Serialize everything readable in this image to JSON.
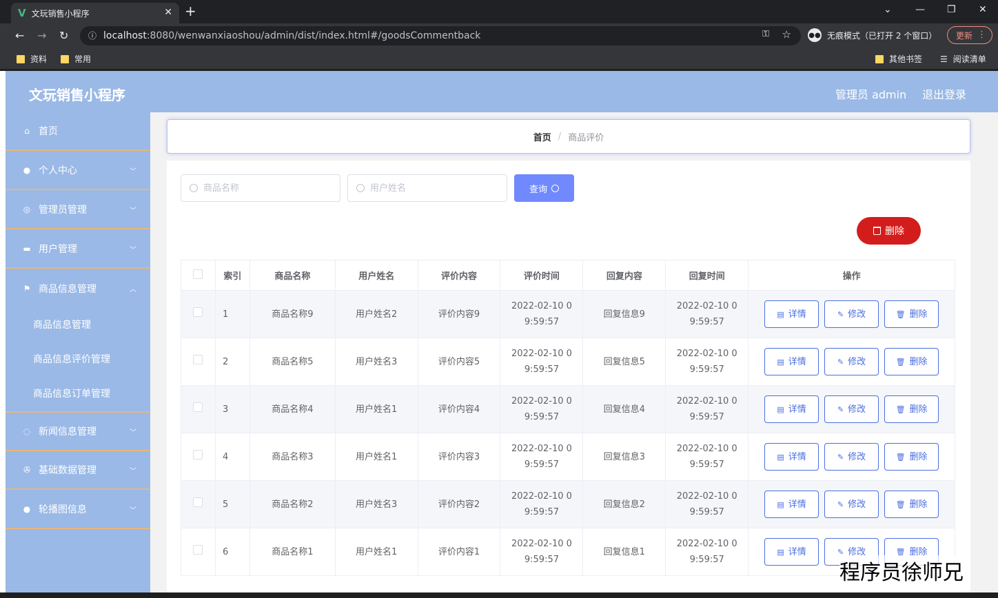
{
  "browser": {
    "tab_title": "文玩销售小程序",
    "tab_close": "✕",
    "new_tab": "+",
    "url_host": "localhost",
    "url_rest": ":8080/wenwanxiaoshou/admin/dist/index.html#/goodsCommentback",
    "incognito_label": "无痕模式（已打开 2 个窗口）",
    "update_label": "更新",
    "bookmarks": [
      "资料",
      "常用"
    ],
    "other_bookmarks": "其他书签",
    "reading_list": "阅读清单"
  },
  "header": {
    "title": "文玩销售小程序",
    "user": "管理员 admin",
    "logout": "退出登录"
  },
  "sidebar": {
    "items": [
      {
        "label": "首页"
      },
      {
        "label": "个人中心"
      },
      {
        "label": "管理员管理"
      },
      {
        "label": "用户管理"
      },
      {
        "label": "商品信息管理"
      },
      {
        "label": "新闻信息管理"
      },
      {
        "label": "基础数据管理"
      },
      {
        "label": "轮播图信息"
      }
    ],
    "sub_items": [
      {
        "label": "商品信息管理"
      },
      {
        "label": "商品信息评价管理"
      },
      {
        "label": "商品信息订单管理"
      }
    ]
  },
  "breadcrumb": {
    "home": "首页",
    "sep": "/",
    "current": "商品评价"
  },
  "search": {
    "goods_placeholder": "商品名称",
    "user_placeholder": "用户姓名",
    "query_label": "查询"
  },
  "delete_label": "删除",
  "table": {
    "headers": [
      "索引",
      "商品名称",
      "用户姓名",
      "评价内容",
      "评价时间",
      "回复内容",
      "回复时间",
      "操作"
    ],
    "rows": [
      {
        "idx": "1",
        "goods": "商品名称9",
        "user": "用户姓名2",
        "content": "评价内容9",
        "time_a": "2022-02-10 0",
        "time_b": "9:59:57",
        "reply": "回复信息9",
        "rtime_a": "2022-02-10 0",
        "rtime_b": "9:59:57"
      },
      {
        "idx": "2",
        "goods": "商品名称5",
        "user": "用户姓名3",
        "content": "评价内容5",
        "time_a": "2022-02-10 0",
        "time_b": "9:59:57",
        "reply": "回复信息5",
        "rtime_a": "2022-02-10 0",
        "rtime_b": "9:59:57"
      },
      {
        "idx": "3",
        "goods": "商品名称4",
        "user": "用户姓名1",
        "content": "评价内容4",
        "time_a": "2022-02-10 0",
        "time_b": "9:59:57",
        "reply": "回复信息4",
        "rtime_a": "2022-02-10 0",
        "rtime_b": "9:59:57"
      },
      {
        "idx": "4",
        "goods": "商品名称3",
        "user": "用户姓名1",
        "content": "评价内容3",
        "time_a": "2022-02-10 0",
        "time_b": "9:59:57",
        "reply": "回复信息3",
        "rtime_a": "2022-02-10 0",
        "rtime_b": "9:59:57"
      },
      {
        "idx": "5",
        "goods": "商品名称2",
        "user": "用户姓名3",
        "content": "评价内容2",
        "time_a": "2022-02-10 0",
        "time_b": "9:59:57",
        "reply": "回复信息2",
        "rtime_a": "2022-02-10 0",
        "rtime_b": "9:59:57"
      },
      {
        "idx": "6",
        "goods": "商品名称1",
        "user": "用户姓名1",
        "content": "评价内容1",
        "time_a": "2022-02-10 0",
        "time_b": "9:59:57",
        "reply": "回复信息1",
        "rtime_a": "2022-02-10 0",
        "rtime_b": "9:59:57"
      }
    ],
    "actions": {
      "detail": "详情",
      "edit": "修改",
      "delete": "删除"
    }
  },
  "watermark": "程序员徐师兄",
  "colors": {
    "header": "#9ab9e6",
    "accent": "#7089ff",
    "danger": "#d31d1d",
    "divider": "#e7b67e"
  }
}
